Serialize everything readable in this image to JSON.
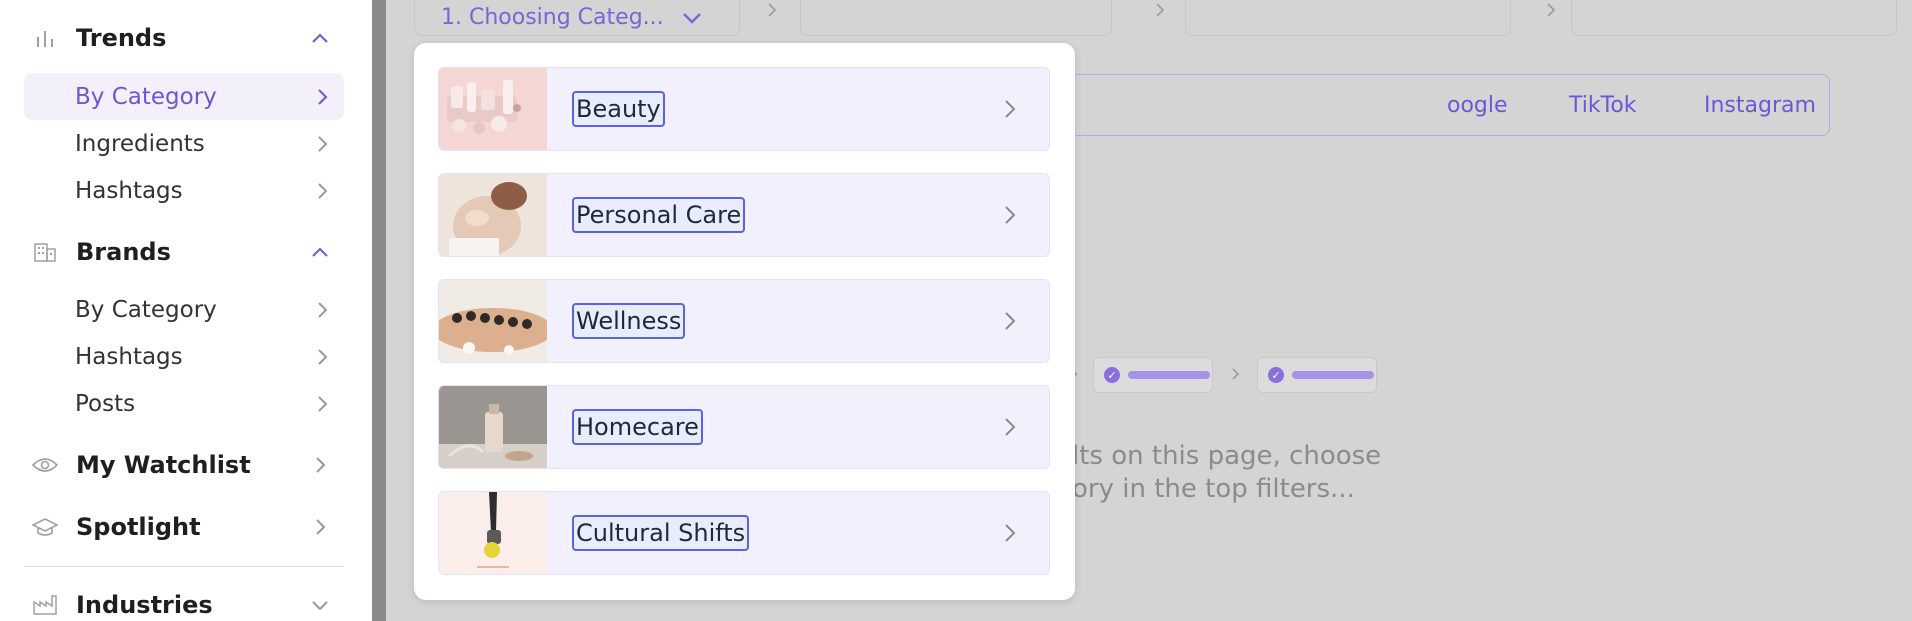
{
  "sidebar": {
    "trends": {
      "label": "Trends",
      "icon": "bar-chart-icon",
      "items": [
        "By Category",
        "Ingredients",
        "Hashtags"
      ]
    },
    "brands": {
      "label": "Brands",
      "icon": "building-icon",
      "items": [
        "By Category",
        "Hashtags",
        "Posts"
      ]
    },
    "watchlist": {
      "label": "My Watchlist",
      "icon": "eye-icon"
    },
    "spotlight": {
      "label": "Spotlight",
      "icon": "graduation-cap-icon"
    },
    "industries": {
      "label": "Industries",
      "icon": "factory-icon"
    }
  },
  "topbar": {
    "step1_label": "1. Choosing Categ..."
  },
  "sources": {
    "google": "oogle",
    "tiktok": "TikTok",
    "instagram": "Instagram"
  },
  "hint": {
    "line1": "lts on this page, choose",
    "line2": "ory in the top filters..."
  },
  "dropdown": {
    "categories": [
      {
        "label": "Beauty"
      },
      {
        "label": "Personal Care"
      },
      {
        "label": "Wellness"
      },
      {
        "label": "Homecare"
      },
      {
        "label": "Cultural Shifts"
      }
    ]
  },
  "colors": {
    "accent": "#6e57d6",
    "active_bg": "#f3f0fb",
    "highlight": "#5863e6"
  }
}
